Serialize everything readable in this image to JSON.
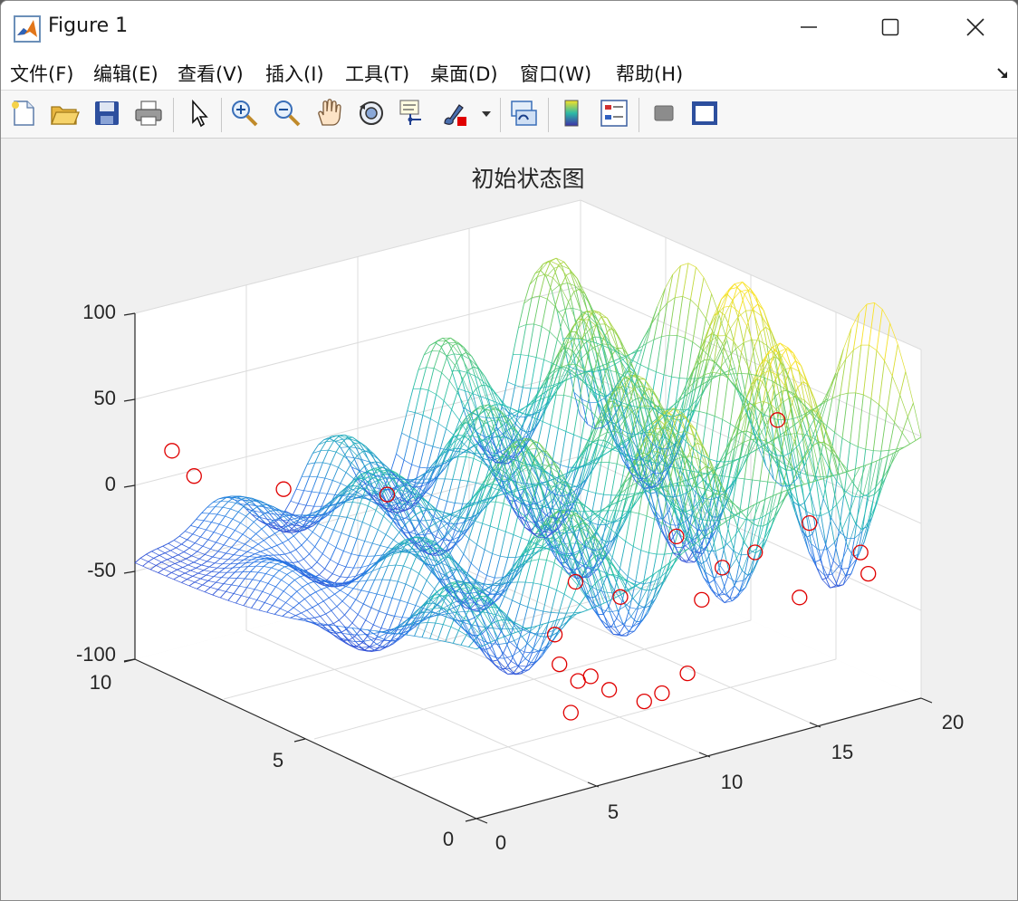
{
  "window": {
    "title": "Figure 1"
  },
  "menu": [
    {
      "label": "文件(F)"
    },
    {
      "label": "编辑(E)"
    },
    {
      "label": "查看(V)"
    },
    {
      "label": "插入(I)"
    },
    {
      "label": "工具(T)"
    },
    {
      "label": "桌面(D)"
    },
    {
      "label": "窗口(W)"
    },
    {
      "label": "帮助(H)"
    }
  ],
  "toolbar": [
    {
      "icon": "new-figure-icon"
    },
    {
      "icon": "open-file-icon"
    },
    {
      "icon": "save-icon"
    },
    {
      "icon": "print-icon"
    },
    {
      "icon": "edit-plot-arrow-icon"
    },
    {
      "icon": "zoom-in-icon"
    },
    {
      "icon": "zoom-out-icon"
    },
    {
      "icon": "pan-hand-icon"
    },
    {
      "icon": "rotate-3d-icon"
    },
    {
      "icon": "data-cursor-icon"
    },
    {
      "icon": "brush-icon"
    },
    {
      "icon": "link-plot-icon"
    },
    {
      "icon": "colorbar-icon"
    },
    {
      "icon": "legend-icon"
    },
    {
      "icon": "hide-plot-tools-icon"
    },
    {
      "icon": "show-plot-tools-icon"
    }
  ],
  "colors": {
    "surface_low": "#3d6ee8",
    "surface_mid": "#22c0b0",
    "surface_high": "#f2e01a",
    "marker": "#e00000"
  },
  "chart_data": {
    "type": "surface",
    "title": "初始状态图",
    "xlabel": "",
    "ylabel": "",
    "zlabel": "",
    "xlim": [
      0,
      20
    ],
    "ylim": [
      0,
      10
    ],
    "zlim": [
      -100,
      100
    ],
    "x_ticks": [
      "0",
      "5",
      "10",
      "15",
      "20"
    ],
    "y_ticks": [
      "0",
      "5",
      "10"
    ],
    "z_ticks": [
      "-100",
      "-50",
      "0",
      "50",
      "100"
    ],
    "grid": true,
    "colormap": "parula",
    "surface": {
      "style": "mesh",
      "z_range": [
        -58,
        102
      ],
      "pattern": "oscillating ridges with peaks along the diagonal"
    },
    "scatter": {
      "marker": "o",
      "color": "red",
      "points": [
        {
          "x": 16.0,
          "y": 1.6,
          "z": 60
        },
        {
          "x": 0.9,
          "y": 9.5,
          "z": 22
        },
        {
          "x": 2.2,
          "y": 9.7,
          "z": 1
        },
        {
          "x": 3.0,
          "y": 7.6,
          "z": 10
        },
        {
          "x": 5.2,
          "y": 6.0,
          "z": 14
        },
        {
          "x": 11.3,
          "y": 1.5,
          "z": 10
        },
        {
          "x": 15.9,
          "y": 0.6,
          "z": 10
        },
        {
          "x": 13.3,
          "y": 0.5,
          "z": 3
        },
        {
          "x": 12.6,
          "y": 1.0,
          "z": -8
        },
        {
          "x": 8.3,
          "y": 2.5,
          "z": -15
        },
        {
          "x": 9.7,
          "y": 2.1,
          "z": -25
        },
        {
          "x": 6.6,
          "y": 2.0,
          "z": -35
        },
        {
          "x": 6.5,
          "y": 1.8,
          "z": -50
        },
        {
          "x": 5.8,
          "y": 0.8,
          "z": -48
        },
        {
          "x": 7.2,
          "y": 0.8,
          "z": -58
        },
        {
          "x": 5.6,
          "y": 0.3,
          "z": -40
        },
        {
          "x": 12.9,
          "y": 1.8,
          "z": -35
        },
        {
          "x": 15.3,
          "y": 0.5,
          "z": -30
        },
        {
          "x": 18.2,
          "y": 0.6,
          "z": -15
        },
        {
          "x": 18.7,
          "y": 0.7,
          "z": -30
        },
        {
          "x": 7.7,
          "y": 0.1,
          "z": -60
        },
        {
          "x": 9.8,
          "y": 0.2,
          "z": -52
        },
        {
          "x": 8.5,
          "y": 0.1,
          "z": -58
        },
        {
          "x": 4.4,
          "y": 0.1,
          "z": -55
        }
      ]
    }
  }
}
